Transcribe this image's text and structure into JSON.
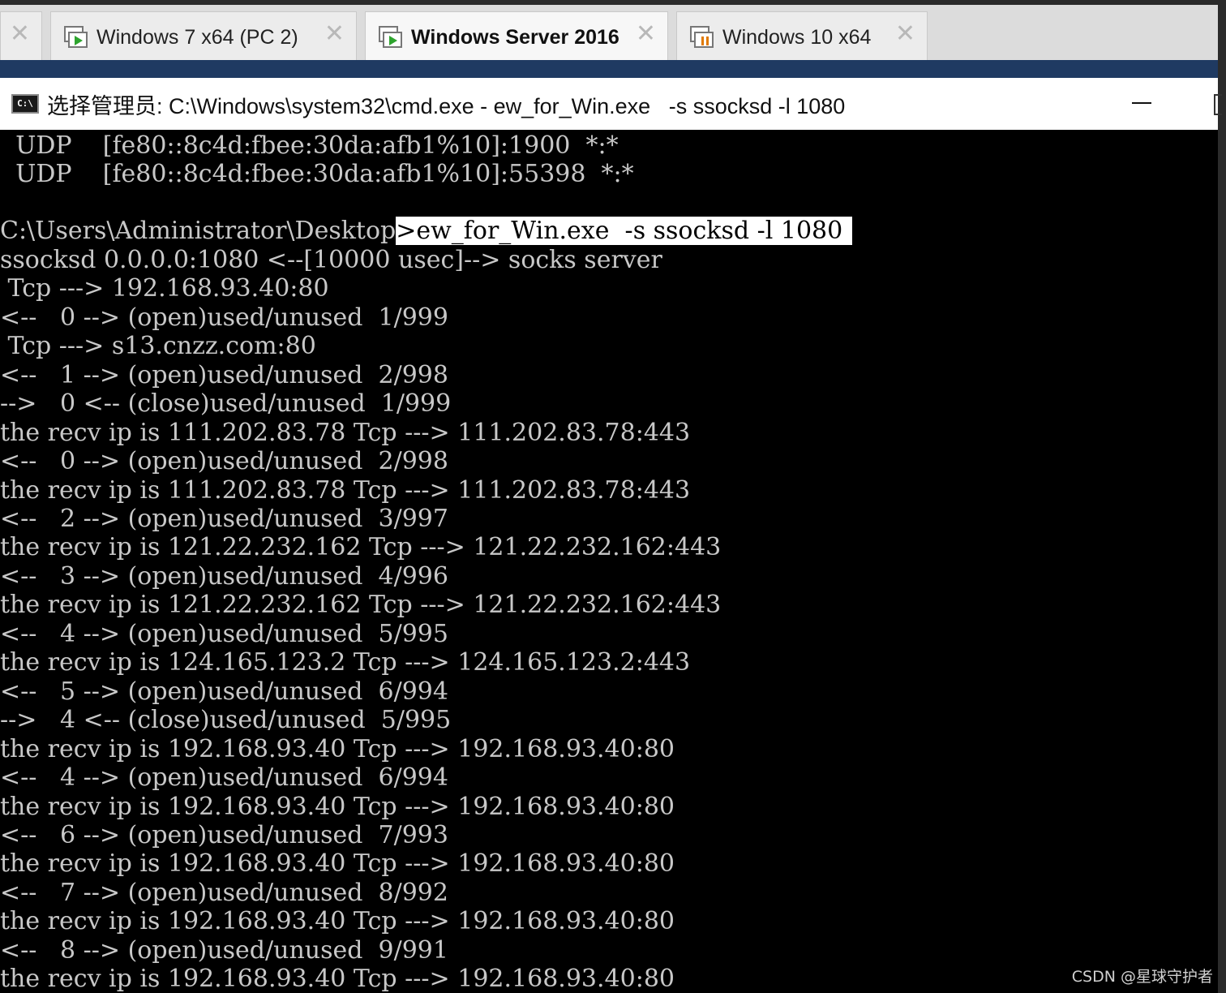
{
  "vm_tabs": [
    {
      "label": "Windows 7 x64 (PC 2)",
      "close": "✕",
      "icon": "vm-running-icon",
      "active": false
    },
    {
      "label": "Windows Server 2016",
      "close": "✕",
      "icon": "vm-running-icon",
      "active": true
    },
    {
      "label": "Windows 10 x64",
      "close": "✕",
      "icon": "vm-paused-icon",
      "active": false
    }
  ],
  "leftmost_tab_close": "✕",
  "window": {
    "title": "选择管理员: C:\\Windows\\system32\\cmd.exe - ew_for_Win.exe   -s ssocksd -l 1080",
    "icon": "cmd-icon",
    "icon_text": "C:\\"
  },
  "console": {
    "lines": [
      "  UDP    [fe80::8c4d:fbee:30da:afb1%10]:1900  *:*",
      "  UDP    [fe80::8c4d:fbee:30da:afb1%10]:55398  *:*",
      "",
      "C:\\Users\\Administrator\\Desktop",
      "ssocksd 0.0.0.0:1080 <--[10000 usec]--> socks server",
      " Tcp ---> 192.168.93.40:80",
      "<--   0 --> (open)used/unused  1/999",
      " Tcp ---> s13.cnzz.com:80",
      "<--   1 --> (open)used/unused  2/998",
      "-->   0 <-- (close)used/unused  1/999",
      "the recv ip is 111.202.83.78 Tcp ---> 111.202.83.78:443",
      "<--   0 --> (open)used/unused  2/998",
      "the recv ip is 111.202.83.78 Tcp ---> 111.202.83.78:443",
      "<--   2 --> (open)used/unused  3/997",
      "the recv ip is 121.22.232.162 Tcp ---> 121.22.232.162:443",
      "<--   3 --> (open)used/unused  4/996",
      "the recv ip is 121.22.232.162 Tcp ---> 121.22.232.162:443",
      "<--   4 --> (open)used/unused  5/995",
      "the recv ip is 124.165.123.2 Tcp ---> 124.165.123.2:443",
      "<--   5 --> (open)used/unused  6/994",
      "-->   4 <-- (close)used/unused  5/995",
      "the recv ip is 192.168.93.40 Tcp ---> 192.168.93.40:80",
      "<--   4 --> (open)used/unused  6/994",
      "the recv ip is 192.168.93.40 Tcp ---> 192.168.93.40:80",
      "<--   6 --> (open)used/unused  7/993",
      "the recv ip is 192.168.93.40 Tcp ---> 192.168.93.40:80",
      "<--   7 --> (open)used/unused  8/992",
      "the recv ip is 192.168.93.40 Tcp ---> 192.168.93.40:80",
      "<--   8 --> (open)used/unused  9/991",
      "the recv ip is 192.168.93.40 Tcp ---> 192.168.93.40:80"
    ],
    "selected_command": ">ew_for_Win.exe  -s ssocksd -l 1080",
    "selected_line_index": 3
  },
  "watermark": "CSDN @星球守护者",
  "colors": {
    "console_bg": "#000000",
    "console_text": "#c8c8c8",
    "selection_bg": "#ffffff",
    "tab_strip": "#dcdcdc",
    "title_band": "#1f3a62"
  }
}
